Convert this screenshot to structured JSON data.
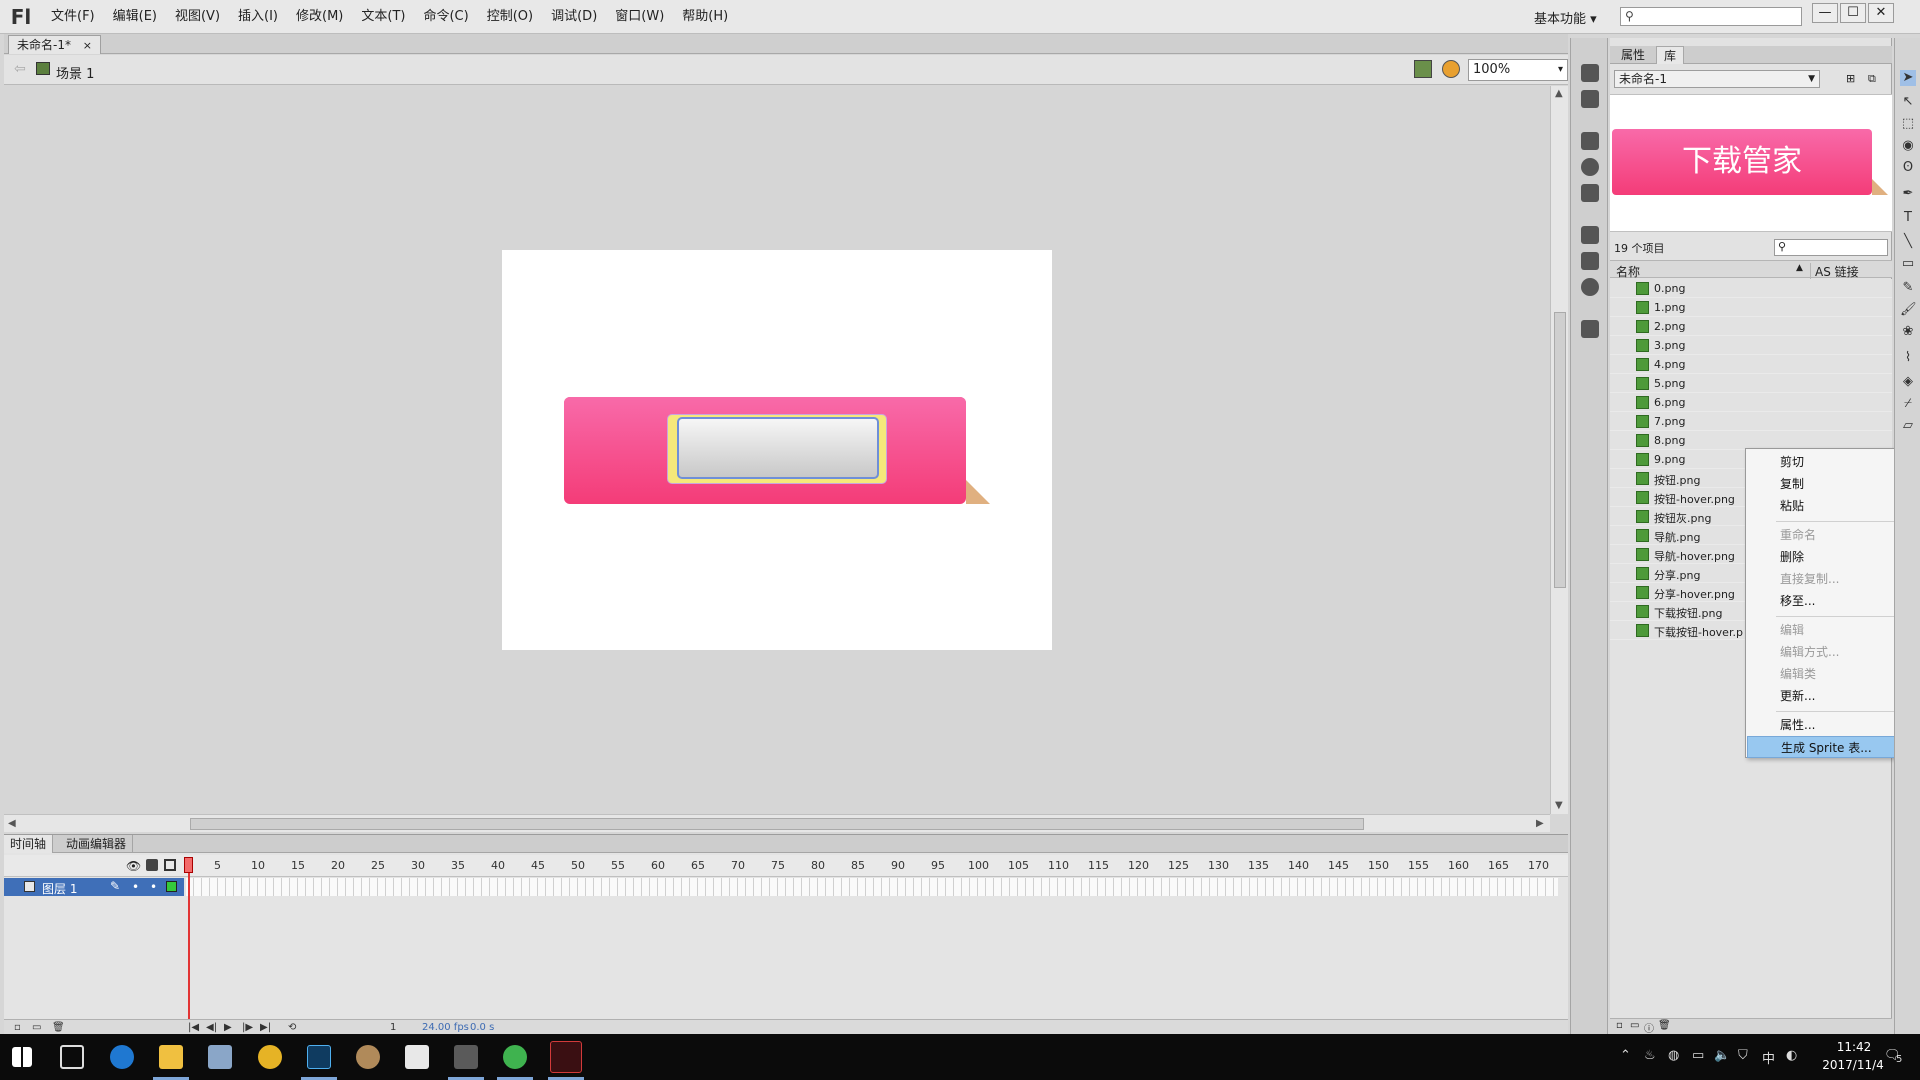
{
  "app": {
    "logo": "Fl"
  },
  "menubar": {
    "items": [
      "文件(F)",
      "编辑(E)",
      "视图(V)",
      "插入(I)",
      "修改(M)",
      "文本(T)",
      "命令(C)",
      "控制(O)",
      "调试(D)",
      "窗口(W)",
      "帮助(H)"
    ],
    "workspace": "基本功能 ▾"
  },
  "window_buttons": {
    "minimize": "—",
    "maximize": "☐",
    "close": "✕"
  },
  "document": {
    "tab_title": "未命名-1*",
    "tab_close": "×",
    "scene_label": "场景 1",
    "zoom": "100%"
  },
  "timeline": {
    "tabs": [
      "时间轴",
      "动画编辑器"
    ],
    "frame_numbers": [
      "5",
      "10",
      "15",
      "20",
      "25",
      "30",
      "35",
      "40",
      "45",
      "50",
      "55",
      "60",
      "65",
      "70",
      "75",
      "80",
      "85",
      "90",
      "95",
      "100",
      "105",
      "110",
      "115",
      "120",
      "125",
      "130",
      "135",
      "140",
      "145",
      "150",
      "155",
      "160",
      "165",
      "170"
    ],
    "layer_name": "图层 1",
    "footer": {
      "current_frame": "1",
      "fps": "24.00 fps",
      "time": "0.0 s"
    }
  },
  "library": {
    "tabs": {
      "properties": "属性",
      "library": "库"
    },
    "document_select": "未命名-1",
    "preview_text": "下载管家",
    "item_count": "19 个项目",
    "columns": {
      "name": "名称",
      "as_link": "AS 链接"
    },
    "items": [
      "0.png",
      "1.png",
      "2.png",
      "3.png",
      "4.png",
      "5.png",
      "6.png",
      "7.png",
      "8.png",
      "9.png",
      "按钮.png",
      "按钮-hover.png",
      "按钮灰.png",
      "导航.png",
      "导航-hover.png",
      "分享.png",
      "分享-hover.png",
      "下载按钮.png",
      "下载按钮-hover.p"
    ]
  },
  "context_menu": {
    "cut": "剪切",
    "copy": "复制",
    "paste": "粘贴",
    "rename": "重命名",
    "delete": "删除",
    "duplicate": "直接复制...",
    "move_to": "移至...",
    "edit": "编辑",
    "edit_with": "编辑方式...",
    "edit_class": "编辑类",
    "update": "更新...",
    "properties": "属性...",
    "generate_sprite": "生成 Sprite 表..."
  },
  "taskbar": {
    "tray": {
      "ime": "中",
      "notifications": "5"
    },
    "time": "11:42",
    "date": "2017/11/4"
  },
  "colors": {
    "banner_top": "#f86aa9",
    "banner_bottom": "#f43c78",
    "layer_selected": "#3f6fb8",
    "menu_highlight": "#98c8f0",
    "playhead": "#e23434"
  }
}
